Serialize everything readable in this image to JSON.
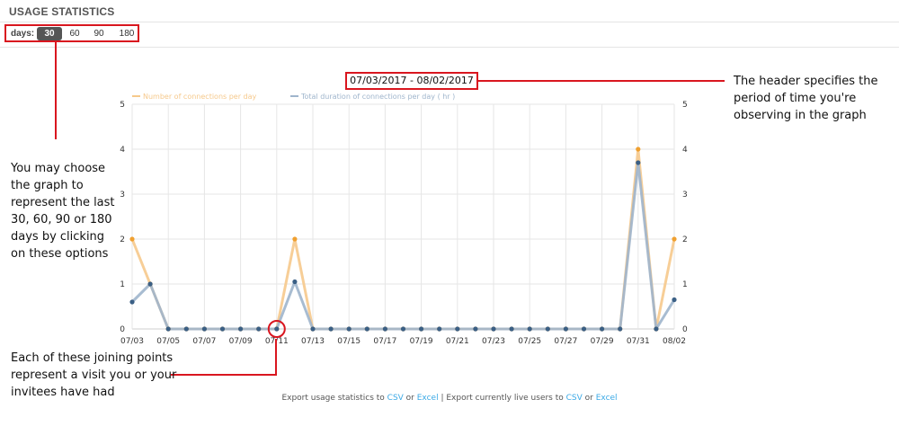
{
  "header": {
    "title": "USAGE STATISTICS"
  },
  "days_selector": {
    "label": "days:",
    "options": [
      "30",
      "60",
      "90",
      "180"
    ],
    "selected": "30"
  },
  "date_range": "07/03/2017 - 08/02/2017",
  "annotations": {
    "header": "The header specifies the period of time you're observing in the graph",
    "days": "You may choose the graph to represent the last 30, 60, 90 or 180 days by clicking on these options",
    "points": "Each of these joining points represent a visit you or your invitees have had"
  },
  "footer": {
    "text1": "Export usage statistics to ",
    "csv1": "CSV",
    "or1": " or ",
    "excel1": "Excel",
    "sep": " | Export currently live users to ",
    "csv2": "CSV",
    "or2": " or ",
    "excel2": "Excel"
  },
  "colors": {
    "accent_red": "#d9161f",
    "connections": "#f6c98c",
    "connections_dot": "#f0a030",
    "duration": "#9fb5cc",
    "duration_dot": "#3a5f85",
    "link": "#3ba9e6"
  },
  "chart_data": {
    "type": "line",
    "x": [
      "07/03",
      "07/04",
      "07/05",
      "07/06",
      "07/07",
      "07/08",
      "07/09",
      "07/10",
      "07/11",
      "07/12",
      "07/13",
      "07/14",
      "07/15",
      "07/16",
      "07/17",
      "07/18",
      "07/19",
      "07/20",
      "07/21",
      "07/22",
      "07/23",
      "07/24",
      "07/25",
      "07/26",
      "07/27",
      "07/28",
      "07/29",
      "07/30",
      "07/31",
      "08/01",
      "08/02"
    ],
    "tick_labels": [
      "07/03",
      "07/05",
      "07/07",
      "07/09",
      "07/11",
      "07/13",
      "07/15",
      "07/17",
      "07/19",
      "07/21",
      "07/23",
      "07/25",
      "07/27",
      "07/29",
      "07/31",
      "08/02"
    ],
    "series": [
      {
        "name": "Number of connections per day",
        "values": [
          2,
          1,
          0,
          0,
          0,
          0,
          0,
          0,
          0,
          2,
          0,
          0,
          0,
          0,
          0,
          0,
          0,
          0,
          0,
          0,
          0,
          0,
          0,
          0,
          0,
          0,
          0,
          0,
          4,
          0,
          2
        ]
      },
      {
        "name": "Total duration of connections per day ( hr )",
        "values": [
          0.6,
          1,
          0,
          0,
          0,
          0,
          0,
          0,
          0,
          1.05,
          0,
          0,
          0,
          0,
          0,
          0,
          0,
          0,
          0,
          0,
          0,
          0,
          0,
          0,
          0,
          0,
          0,
          0,
          3.7,
          0,
          0.65
        ]
      }
    ],
    "ylim": [
      0,
      5
    ],
    "yticks": [
      0,
      1,
      2,
      3,
      4,
      5
    ],
    "grid": true,
    "legend": "top-left"
  }
}
